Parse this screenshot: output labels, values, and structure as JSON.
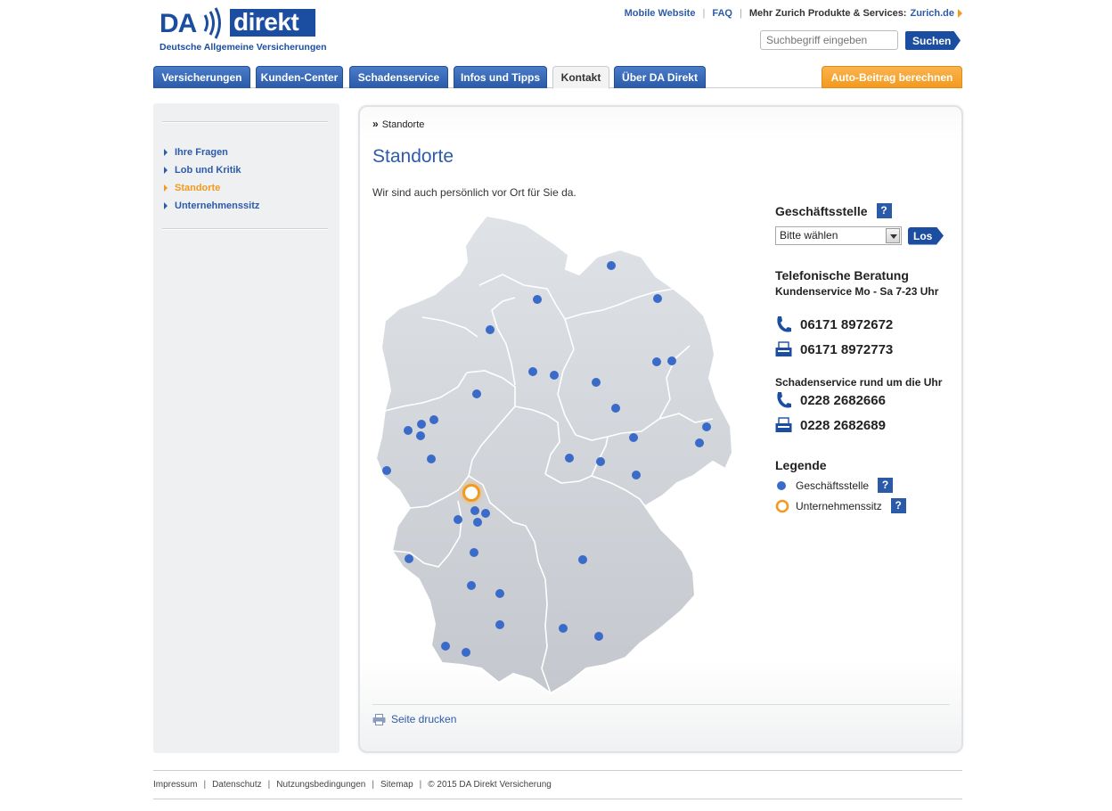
{
  "header": {
    "logo_da": "DA",
    "logo_direkt": "direkt",
    "logo_tagline": "Deutsche Allgemeine Versicherungen",
    "top_links": [
      {
        "label": "Mobile Website"
      },
      {
        "label": "FAQ"
      }
    ],
    "more_products_label": "Mehr Zurich Produkte & Services:",
    "more_products_link": "Zurich.de",
    "search_placeholder": "Suchbegriff eingeben",
    "search_button": "Suchen"
  },
  "nav": {
    "tabs": [
      {
        "label": "Versicherungen"
      },
      {
        "label": "Kunden-Center"
      },
      {
        "label": "Schadenservice"
      },
      {
        "label": "Infos und Tipps"
      },
      {
        "label": "Kontakt",
        "active": true
      },
      {
        "label": "Über DA Direkt"
      }
    ],
    "cta": "Auto-Beitrag berechnen"
  },
  "sidebar": {
    "items": [
      {
        "label": "Ihre Fragen"
      },
      {
        "label": "Lob und Kritik"
      },
      {
        "label": "Standorte",
        "current": true
      },
      {
        "label": "Unternehmenssitz"
      }
    ]
  },
  "content": {
    "breadcrumb": "Standorte",
    "title": "Standorte",
    "intro": "Wir sind auch persönlich vor Ort für Sie da.",
    "print_label": "Seite drucken"
  },
  "right_panel": {
    "branch_heading": "Geschäftsstelle",
    "help_mark": "?",
    "select_value": "Bitte wählen",
    "go_button": "Los",
    "phone_heading": "Telefonische Beratung",
    "phone_hours": "Kundenservice Mo - Sa 7-23 Uhr",
    "phone_number": "06171 8972672",
    "fax_number": "06171 8972773",
    "claims_heading": "Schadenservice rund um die Uhr",
    "claims_phone": "0228 2682666",
    "claims_fax": "0228 2682689",
    "legend_heading": "Legende",
    "legend_branch": "Geschäftsstelle",
    "legend_hq": "Unternehmenssitz"
  },
  "colors": {
    "brand_blue": "#1b4ea0",
    "link_blue": "#2e5ba9",
    "accent_orange": "#f39a1e",
    "dot_blue": "#3a6bc8"
  },
  "footer": {
    "links": [
      {
        "label": "Impressum"
      },
      {
        "label": "Datenschutz"
      },
      {
        "label": "Nutzungsbedingungen"
      },
      {
        "label": "Sitemap"
      },
      {
        "label": "© 2015 DA Direkt Versicherung"
      }
    ]
  }
}
